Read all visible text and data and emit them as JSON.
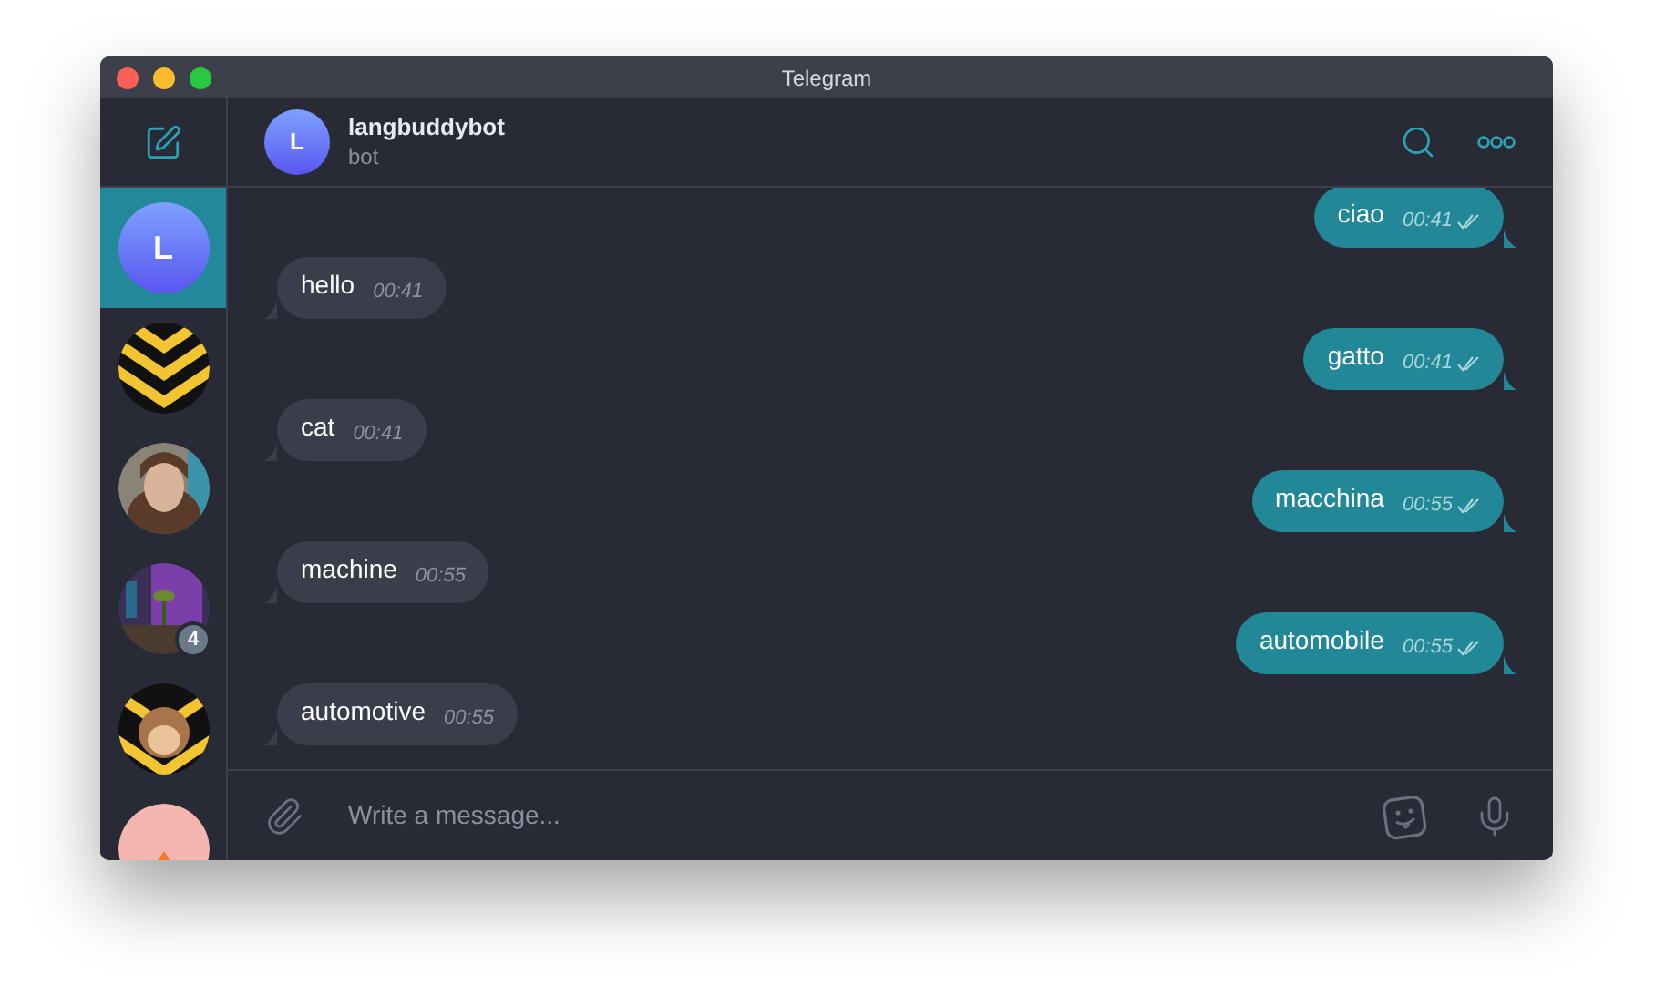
{
  "window": {
    "title": "Telegram"
  },
  "sidebar": {
    "chats": [
      {
        "kind": "letter",
        "initial": "L",
        "selected": true
      },
      {
        "kind": "picture",
        "selected": false
      },
      {
        "kind": "picture",
        "selected": false
      },
      {
        "kind": "picture",
        "selected": false,
        "badge": "4"
      },
      {
        "kind": "picture",
        "selected": false
      },
      {
        "kind": "picture",
        "selected": false
      }
    ]
  },
  "header": {
    "initial": "L",
    "name": "langbuddybot",
    "status": "bot"
  },
  "messages": [
    {
      "outgoing": true,
      "text": "ciao",
      "time": "00:41",
      "read": true
    },
    {
      "outgoing": false,
      "text": "hello",
      "time": "00:41",
      "read": false
    },
    {
      "outgoing": true,
      "text": "gatto",
      "time": "00:41",
      "read": true
    },
    {
      "outgoing": false,
      "text": "cat",
      "time": "00:41",
      "read": false
    },
    {
      "outgoing": true,
      "text": "macchina",
      "time": "00:55",
      "read": true
    },
    {
      "outgoing": false,
      "text": "machine",
      "time": "00:55",
      "read": false
    },
    {
      "outgoing": true,
      "text": "automobile",
      "time": "00:55",
      "read": true
    },
    {
      "outgoing": false,
      "text": "automotive",
      "time": "00:55",
      "read": false
    }
  ],
  "composer": {
    "placeholder": "Write a message..."
  }
}
